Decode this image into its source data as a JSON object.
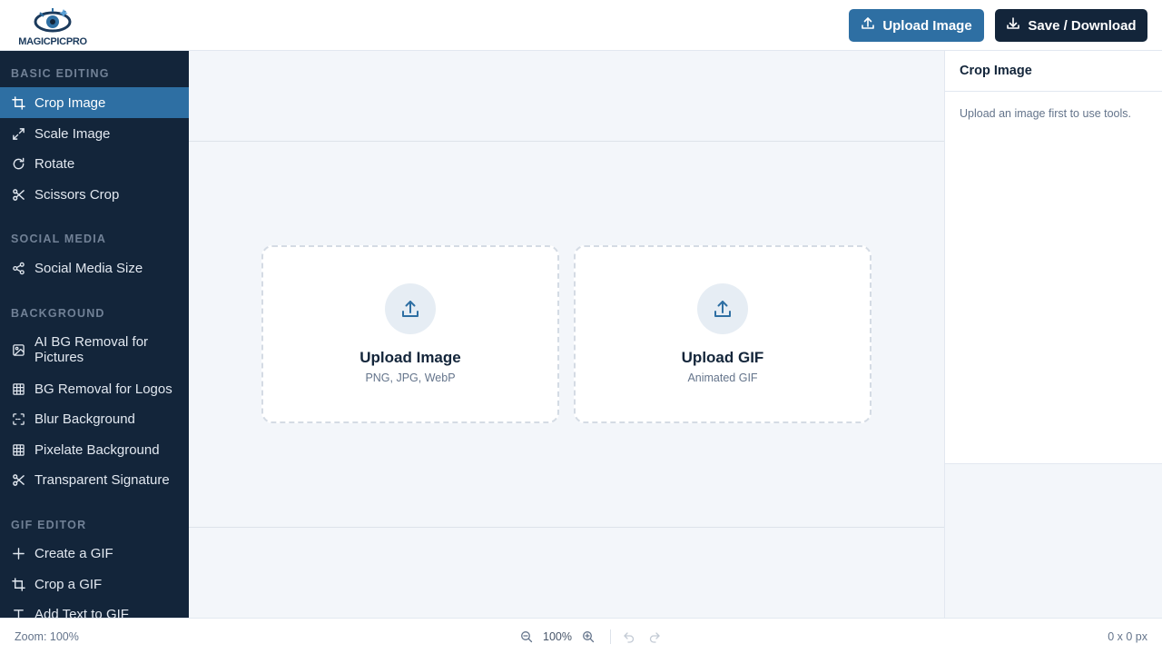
{
  "header": {
    "logo_text": "MAGICPICPRO",
    "upload_button": "Upload Image",
    "save_button": "Save / Download"
  },
  "sidebar": {
    "sections": [
      {
        "title": "BASIC EDITING",
        "items": [
          {
            "label": "Crop Image",
            "icon": "crop-icon",
            "active": true
          },
          {
            "label": "Scale Image",
            "icon": "expand-icon"
          },
          {
            "label": "Rotate",
            "icon": "rotate-icon"
          },
          {
            "label": "Scissors Crop",
            "icon": "scissors-icon"
          }
        ]
      },
      {
        "title": "SOCIAL MEDIA",
        "items": [
          {
            "label": "Social Media Size",
            "icon": "share-icon"
          }
        ]
      },
      {
        "title": "BACKGROUND",
        "items": [
          {
            "label": "AI BG Removal for Pictures",
            "icon": "image-icon"
          },
          {
            "label": "BG Removal for Logos",
            "icon": "grid-icon"
          },
          {
            "label": "Blur Background",
            "icon": "focus-icon"
          },
          {
            "label": "Pixelate Background",
            "icon": "grid-icon"
          },
          {
            "label": "Transparent Signature",
            "icon": "scissors-icon"
          }
        ]
      },
      {
        "title": "GIF EDITOR",
        "items": [
          {
            "label": "Create a GIF",
            "icon": "plus-icon"
          },
          {
            "label": "Crop a GIF",
            "icon": "crop-icon"
          },
          {
            "label": "Add Text to GIF",
            "icon": "text-icon"
          }
        ]
      }
    ]
  },
  "canvas": {
    "cards": [
      {
        "title": "Upload Image",
        "subtitle": "PNG, JPG, WebP"
      },
      {
        "title": "Upload GIF",
        "subtitle": "Animated GIF"
      }
    ]
  },
  "panel": {
    "title": "Crop Image",
    "message": "Upload an image first to use tools."
  },
  "status": {
    "zoom_label": "Zoom: 100%",
    "zoom_value": "100%",
    "dimensions": "0 x 0 px"
  },
  "colors": {
    "accent": "#2e6fa3",
    "sidebar_bg": "#13253a",
    "save_button_bg": "#13253a"
  }
}
